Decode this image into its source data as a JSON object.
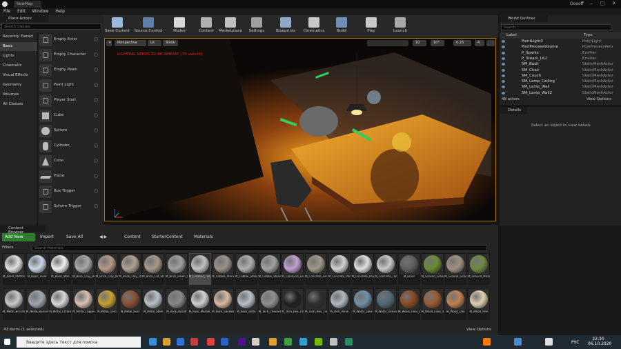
{
  "title": {
    "tab": "NewMap",
    "user": "Ooooff"
  },
  "menu": [
    "File",
    "Edit",
    "Window",
    "Help"
  ],
  "place_actors": {
    "tab": "Place Actors",
    "search_placeholder": "Search Classes",
    "categories": [
      "Recently Placed",
      "Basic",
      "Lights",
      "Cinematic",
      "Visual Effects",
      "Geometry",
      "Volumes",
      "All Classes"
    ],
    "selected_category": "Basic",
    "items": [
      "Empty Actor",
      "Empty Character",
      "Empty Pawn",
      "Point Light",
      "Player Start",
      "Cube",
      "Sphere",
      "Cylinder",
      "Cone",
      "Plane",
      "Box Trigger",
      "Sphere Trigger"
    ]
  },
  "toolbar": [
    {
      "label": "Save Current",
      "color": "#9ab8d8"
    },
    {
      "label": "Source Control",
      "color": "#5f7fa8"
    },
    {
      "label": "Modes",
      "color": "#d8d8d8"
    },
    {
      "label": "Content",
      "color": "#b0b0b0"
    },
    {
      "label": "Marketplace",
      "color": "#c0c0c0"
    },
    {
      "label": "Settings",
      "color": "#a0a0a0"
    },
    {
      "label": "Blueprints",
      "color": "#8fa8c8"
    },
    {
      "label": "Cinematics",
      "color": "#c8c8c8"
    },
    {
      "label": "Build",
      "color": "#6f8fb8"
    },
    {
      "label": "Play",
      "color": "#c8c8c8"
    },
    {
      "label": "Launch",
      "color": "#a8a8a8"
    }
  ],
  "viewport": {
    "perspective": "Perspective",
    "lit": "Lit",
    "show": "Show",
    "warning": "LIGHTING NEEDS TO BE REBUILT (75 unbuilt)",
    "grid": "10",
    "angle": "10°",
    "scale": "0.25",
    "camera_speed": "4"
  },
  "outliner": {
    "tab": "World Outliner",
    "search_placeholder": "Search...",
    "col_label": "Label",
    "col_type": "Type",
    "rows": [
      {
        "name": "PointLight3",
        "type": "PointLight"
      },
      {
        "name": "PostProcessVolume",
        "type": "PostProcessVolu"
      },
      {
        "name": "P_Sparks",
        "type": "Emitter"
      },
      {
        "name": "P_Steam_Lit2",
        "type": "Emitter"
      },
      {
        "name": "SM_Bush",
        "type": "StaticMeshActor"
      },
      {
        "name": "SM_Chair",
        "type": "StaticMeshActor"
      },
      {
        "name": "SM_Couch",
        "type": "StaticMeshActor"
      },
      {
        "name": "SM_Lamp_Ceiling",
        "type": "StaticMeshActor"
      },
      {
        "name": "SM_Lamp_Wall",
        "type": "StaticMeshActor"
      },
      {
        "name": "SM_Lamp_Wall2",
        "type": "StaticMeshActor"
      }
    ],
    "count": "48 actors",
    "view_options": "View Options"
  },
  "details": {
    "tab": "Details",
    "empty": "Select an object to view details"
  },
  "content_browser": {
    "tab": "Content Browser",
    "add_new": "Add New",
    "import": "Import",
    "save_all": "Save All",
    "path": [
      "Content",
      "StarterContent",
      "Materials"
    ],
    "filters": "Filters",
    "search_placeholder": "Search Materials",
    "status": "43 items (1 selected)",
    "view_options": "View Options",
    "row1": [
      {
        "name": "M_Asset_Platform",
        "color": "#e0e0e0"
      },
      {
        "name": "M_Basic_Floor",
        "color": "#c8d8e8"
      },
      {
        "name": "M_Basic_Wall",
        "color": "#f0f0f0"
      },
      {
        "name": "M_Brick_Clay_Beveled",
        "color": "#a8a8a8"
      },
      {
        "name": "M_Brick_Clay_New",
        "color": "#b89888"
      },
      {
        "name": "M_Brick_Clay_Old",
        "color": "#b0a090"
      },
      {
        "name": "M_Brick_Cut_Stone",
        "color": "#a89888"
      },
      {
        "name": "M_Brick_Hewn_Stone",
        "color": "#a0a0a0"
      },
      {
        "name": "M_Ceramic_Tile_Checker",
        "color": "#c0c0c0"
      },
      {
        "name": "M_Cobble_Stone_Pebble",
        "color": "#9a9088"
      },
      {
        "name": "M_Cobble_Stone_Rough",
        "color": "#b0b0b0"
      },
      {
        "name": "M_Cobble_Stone_Smooth",
        "color": "#a0a0a0"
      },
      {
        "name": "M_ColorGrid_LowSpec",
        "color": "#c0a0d0"
      },
      {
        "name": "M_Concrete_Grime",
        "color": "#a09888"
      },
      {
        "name": "M_Concrete_Panels",
        "color": "#d0d0d0"
      },
      {
        "name": "M_Concrete_Poured",
        "color": "#e0e0e0"
      },
      {
        "name": "M_Concrete_Tiles",
        "color": "#c8c8c8"
      },
      {
        "name": "M_Glass",
        "color": "#606060"
      },
      {
        "name": "M_Ground_Grass",
        "color": "#6a8a30"
      },
      {
        "name": "M_Ground_Gravel",
        "color": "#a09080"
      },
      {
        "name": "M_Ground_Moss",
        "color": "#708a40"
      }
    ],
    "row2": [
      {
        "name": "M_Metal_Brushed_Nickel",
        "color": "#c8c8c8"
      },
      {
        "name": "M_Metal_Burnished_Steel",
        "color": "#a0a8b0"
      },
      {
        "name": "M_Metal_Chrome",
        "color": "#d8d8d8"
      },
      {
        "name": "M_Metal_Copper",
        "color": "#d8c0b0"
      },
      {
        "name": "M_Metal_Gold",
        "color": "#c8a030"
      },
      {
        "name": "M_Metal_Rust",
        "color": "#8a5030"
      },
      {
        "name": "M_Metal_Steel",
        "color": "#b8c0c8"
      },
      {
        "name": "M_Rock_Basalt",
        "color": "#888888"
      },
      {
        "name": "M_Rock_Marble_Polished",
        "color": "#d0d0d0"
      },
      {
        "name": "M_Rock_Sandstone",
        "color": "#d8b8a0"
      },
      {
        "name": "M_Rock_Slate",
        "color": "#b8c0c8"
      },
      {
        "name": "M_Tech_Checker_Dot",
        "color": "#909090"
      },
      {
        "name": "M_Tech_Hex_Tile",
        "color": "#202020"
      },
      {
        "name": "M_Tech_Hex_Tile_Pulse",
        "color": "#303030"
      },
      {
        "name": "M_Tech_Panel",
        "color": "#b0b8c0"
      },
      {
        "name": "M_Water_Lake",
        "color": "#7090a8"
      },
      {
        "name": "M_Water_Ocean",
        "color": "#506878"
      },
      {
        "name": "M_Wood_Floor_Walnut_Polished",
        "color": "#8a4a20"
      },
      {
        "name": "M_Wood_Floor_Walnut_Worn",
        "color": "#9a5a30"
      },
      {
        "name": "M_Wood_Oak",
        "color": "#c08050"
      },
      {
        "name": "M_Wood_Pine",
        "color": "#e0d0b0"
      }
    ]
  },
  "taskbar": {
    "search": "Введите здесь текст для поиска",
    "lang": "РУС",
    "time": "22:30",
    "date": "06.10.2020"
  }
}
